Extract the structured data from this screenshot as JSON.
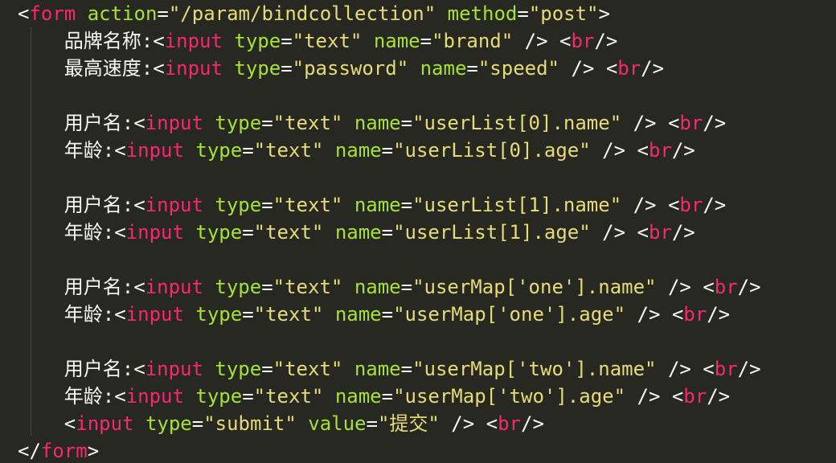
{
  "colors": {
    "background": "#272822",
    "tag": "#f92672",
    "attribute": "#a6e22e",
    "string": "#e6db74",
    "text": "#f8f8f2",
    "indent_guide": "#464741"
  },
  "lines": [
    {
      "indent": 0,
      "tokens": [
        {
          "t": "p",
          "v": "<"
        },
        {
          "t": "t",
          "v": "form"
        },
        {
          "t": "p",
          "v": " "
        },
        {
          "t": "a",
          "v": "action"
        },
        {
          "t": "p",
          "v": "="
        },
        {
          "t": "s",
          "v": "\"/param/bindcollection\""
        },
        {
          "t": "p",
          "v": " "
        },
        {
          "t": "a",
          "v": "method"
        },
        {
          "t": "p",
          "v": "="
        },
        {
          "t": "s",
          "v": "\"post\""
        },
        {
          "t": "p",
          "v": ">"
        }
      ]
    },
    {
      "indent": 1,
      "tokens": [
        {
          "t": "p",
          "v": "品牌名称:<"
        },
        {
          "t": "t",
          "v": "input"
        },
        {
          "t": "p",
          "v": " "
        },
        {
          "t": "a",
          "v": "type"
        },
        {
          "t": "p",
          "v": "="
        },
        {
          "t": "s",
          "v": "\"text\""
        },
        {
          "t": "p",
          "v": " "
        },
        {
          "t": "a",
          "v": "name"
        },
        {
          "t": "p",
          "v": "="
        },
        {
          "t": "s",
          "v": "\"brand\""
        },
        {
          "t": "p",
          "v": " /> <"
        },
        {
          "t": "t",
          "v": "br"
        },
        {
          "t": "p",
          "v": "/>"
        }
      ]
    },
    {
      "indent": 1,
      "tokens": [
        {
          "t": "p",
          "v": "最高速度:<"
        },
        {
          "t": "t",
          "v": "input"
        },
        {
          "t": "p",
          "v": " "
        },
        {
          "t": "a",
          "v": "type"
        },
        {
          "t": "p",
          "v": "="
        },
        {
          "t": "s",
          "v": "\"password\""
        },
        {
          "t": "p",
          "v": " "
        },
        {
          "t": "a",
          "v": "name"
        },
        {
          "t": "p",
          "v": "="
        },
        {
          "t": "s",
          "v": "\"speed\""
        },
        {
          "t": "p",
          "v": " /> <"
        },
        {
          "t": "t",
          "v": "br"
        },
        {
          "t": "p",
          "v": "/>"
        }
      ]
    },
    {
      "indent": 0,
      "tokens": []
    },
    {
      "indent": 1,
      "tokens": [
        {
          "t": "p",
          "v": "用户名:<"
        },
        {
          "t": "t",
          "v": "input"
        },
        {
          "t": "p",
          "v": " "
        },
        {
          "t": "a",
          "v": "type"
        },
        {
          "t": "p",
          "v": "="
        },
        {
          "t": "s",
          "v": "\"text\""
        },
        {
          "t": "p",
          "v": " "
        },
        {
          "t": "a",
          "v": "name"
        },
        {
          "t": "p",
          "v": "="
        },
        {
          "t": "s",
          "v": "\"userList[0].name\""
        },
        {
          "t": "p",
          "v": " /> <"
        },
        {
          "t": "t",
          "v": "br"
        },
        {
          "t": "p",
          "v": "/>"
        }
      ]
    },
    {
      "indent": 1,
      "tokens": [
        {
          "t": "p",
          "v": "年龄:<"
        },
        {
          "t": "t",
          "v": "input"
        },
        {
          "t": "p",
          "v": " "
        },
        {
          "t": "a",
          "v": "type"
        },
        {
          "t": "p",
          "v": "="
        },
        {
          "t": "s",
          "v": "\"text\""
        },
        {
          "t": "p",
          "v": " "
        },
        {
          "t": "a",
          "v": "name"
        },
        {
          "t": "p",
          "v": "="
        },
        {
          "t": "s",
          "v": "\"userList[0].age\""
        },
        {
          "t": "p",
          "v": " /> <"
        },
        {
          "t": "t",
          "v": "br"
        },
        {
          "t": "p",
          "v": "/>"
        }
      ]
    },
    {
      "indent": 0,
      "tokens": []
    },
    {
      "indent": 1,
      "tokens": [
        {
          "t": "p",
          "v": "用户名:<"
        },
        {
          "t": "t",
          "v": "input"
        },
        {
          "t": "p",
          "v": " "
        },
        {
          "t": "a",
          "v": "type"
        },
        {
          "t": "p",
          "v": "="
        },
        {
          "t": "s",
          "v": "\"text\""
        },
        {
          "t": "p",
          "v": " "
        },
        {
          "t": "a",
          "v": "name"
        },
        {
          "t": "p",
          "v": "="
        },
        {
          "t": "s",
          "v": "\"userList[1].name\""
        },
        {
          "t": "p",
          "v": " /> <"
        },
        {
          "t": "t",
          "v": "br"
        },
        {
          "t": "p",
          "v": "/>"
        }
      ]
    },
    {
      "indent": 1,
      "tokens": [
        {
          "t": "p",
          "v": "年龄:<"
        },
        {
          "t": "t",
          "v": "input"
        },
        {
          "t": "p",
          "v": " "
        },
        {
          "t": "a",
          "v": "type"
        },
        {
          "t": "p",
          "v": "="
        },
        {
          "t": "s",
          "v": "\"text\""
        },
        {
          "t": "p",
          "v": " "
        },
        {
          "t": "a",
          "v": "name"
        },
        {
          "t": "p",
          "v": "="
        },
        {
          "t": "s",
          "v": "\"userList[1].age\""
        },
        {
          "t": "p",
          "v": " /> <"
        },
        {
          "t": "t",
          "v": "br"
        },
        {
          "t": "p",
          "v": "/>"
        }
      ]
    },
    {
      "indent": 0,
      "tokens": []
    },
    {
      "indent": 1,
      "tokens": [
        {
          "t": "p",
          "v": "用户名:<"
        },
        {
          "t": "t",
          "v": "input"
        },
        {
          "t": "p",
          "v": " "
        },
        {
          "t": "a",
          "v": "type"
        },
        {
          "t": "p",
          "v": "="
        },
        {
          "t": "s",
          "v": "\"text\""
        },
        {
          "t": "p",
          "v": " "
        },
        {
          "t": "a",
          "v": "name"
        },
        {
          "t": "p",
          "v": "="
        },
        {
          "t": "s",
          "v": "\"userMap['one'].name\""
        },
        {
          "t": "p",
          "v": " /> <"
        },
        {
          "t": "t",
          "v": "br"
        },
        {
          "t": "p",
          "v": "/>"
        }
      ]
    },
    {
      "indent": 1,
      "tokens": [
        {
          "t": "p",
          "v": "年龄:<"
        },
        {
          "t": "t",
          "v": "input"
        },
        {
          "t": "p",
          "v": " "
        },
        {
          "t": "a",
          "v": "type"
        },
        {
          "t": "p",
          "v": "="
        },
        {
          "t": "s",
          "v": "\"text\""
        },
        {
          "t": "p",
          "v": " "
        },
        {
          "t": "a",
          "v": "name"
        },
        {
          "t": "p",
          "v": "="
        },
        {
          "t": "s",
          "v": "\"userMap['one'].age\""
        },
        {
          "t": "p",
          "v": " /> <"
        },
        {
          "t": "t",
          "v": "br"
        },
        {
          "t": "p",
          "v": "/>"
        }
      ]
    },
    {
      "indent": 0,
      "tokens": []
    },
    {
      "indent": 1,
      "tokens": [
        {
          "t": "p",
          "v": "用户名:<"
        },
        {
          "t": "t",
          "v": "input"
        },
        {
          "t": "p",
          "v": " "
        },
        {
          "t": "a",
          "v": "type"
        },
        {
          "t": "p",
          "v": "="
        },
        {
          "t": "s",
          "v": "\"text\""
        },
        {
          "t": "p",
          "v": " "
        },
        {
          "t": "a",
          "v": "name"
        },
        {
          "t": "p",
          "v": "="
        },
        {
          "t": "s",
          "v": "\"userMap['two'].name\""
        },
        {
          "t": "p",
          "v": " /> <"
        },
        {
          "t": "t",
          "v": "br"
        },
        {
          "t": "p",
          "v": "/>"
        }
      ]
    },
    {
      "indent": 1,
      "tokens": [
        {
          "t": "p",
          "v": "年龄:<"
        },
        {
          "t": "t",
          "v": "input"
        },
        {
          "t": "p",
          "v": " "
        },
        {
          "t": "a",
          "v": "type"
        },
        {
          "t": "p",
          "v": "="
        },
        {
          "t": "s",
          "v": "\"text\""
        },
        {
          "t": "p",
          "v": " "
        },
        {
          "t": "a",
          "v": "name"
        },
        {
          "t": "p",
          "v": "="
        },
        {
          "t": "s",
          "v": "\"userMap['two'].age\""
        },
        {
          "t": "p",
          "v": " /> <"
        },
        {
          "t": "t",
          "v": "br"
        },
        {
          "t": "p",
          "v": "/>"
        }
      ]
    },
    {
      "indent": 1,
      "tokens": [
        {
          "t": "p",
          "v": "<"
        },
        {
          "t": "t",
          "v": "input"
        },
        {
          "t": "p",
          "v": " "
        },
        {
          "t": "a",
          "v": "type"
        },
        {
          "t": "p",
          "v": "="
        },
        {
          "t": "s",
          "v": "\"submit\""
        },
        {
          "t": "p",
          "v": " "
        },
        {
          "t": "a",
          "v": "value"
        },
        {
          "t": "p",
          "v": "="
        },
        {
          "t": "s",
          "v": "\"提交\""
        },
        {
          "t": "p",
          "v": " /> <"
        },
        {
          "t": "t",
          "v": "br"
        },
        {
          "t": "p",
          "v": "/>"
        }
      ]
    },
    {
      "indent": 0,
      "tokens": [
        {
          "t": "p",
          "v": "</"
        },
        {
          "t": "t",
          "v": "form"
        },
        {
          "t": "p",
          "v": ">"
        }
      ]
    }
  ]
}
